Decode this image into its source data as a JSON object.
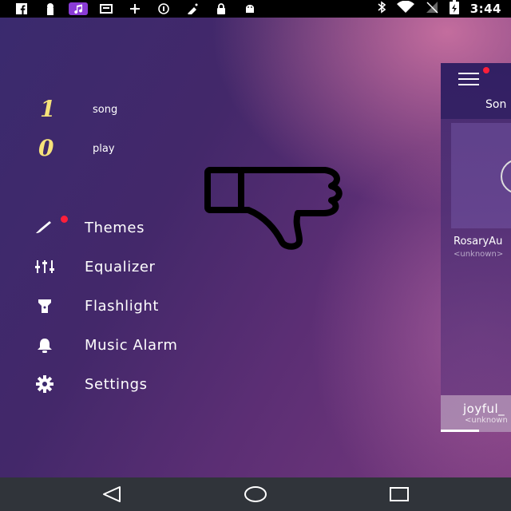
{
  "status_bar": {
    "time": "3:44",
    "left_icons": [
      "facebook-icon",
      "lock-keyhole-icon",
      "music-note-icon",
      "news-icon",
      "fan-icon",
      "data-saver-icon",
      "spray-icon",
      "padlock-icon",
      "android-icon"
    ],
    "right_icons": [
      "bluetooth-icon",
      "wifi-icon",
      "no-signal-icon",
      "battery-charging-icon"
    ]
  },
  "drawer": {
    "stats": [
      {
        "value": "1",
        "label": "song"
      },
      {
        "value": "0",
        "label": "play"
      }
    ],
    "menu": [
      {
        "label": "Themes",
        "icon": "brush-icon",
        "badge": true
      },
      {
        "label": "Equalizer",
        "icon": "equalizer-icon"
      },
      {
        "label": "Flashlight",
        "icon": "flashlight-icon"
      },
      {
        "label": "Music Alarm",
        "icon": "bell-icon"
      },
      {
        "label": "Settings",
        "icon": "gear-icon"
      }
    ],
    "accent_color": "#f6e27a",
    "badge_color": "#ff1f3a"
  },
  "overlay": {
    "icon": "thumbs-down-icon"
  },
  "panel": {
    "tab_label": "Son",
    "song_title": "RosaryAu",
    "song_artist": "<unknown>",
    "mini_player": {
      "title": "joyful_",
      "artist": "<unknown"
    }
  },
  "navigation": {
    "buttons": [
      "back-icon",
      "home-icon",
      "recents-icon"
    ]
  }
}
